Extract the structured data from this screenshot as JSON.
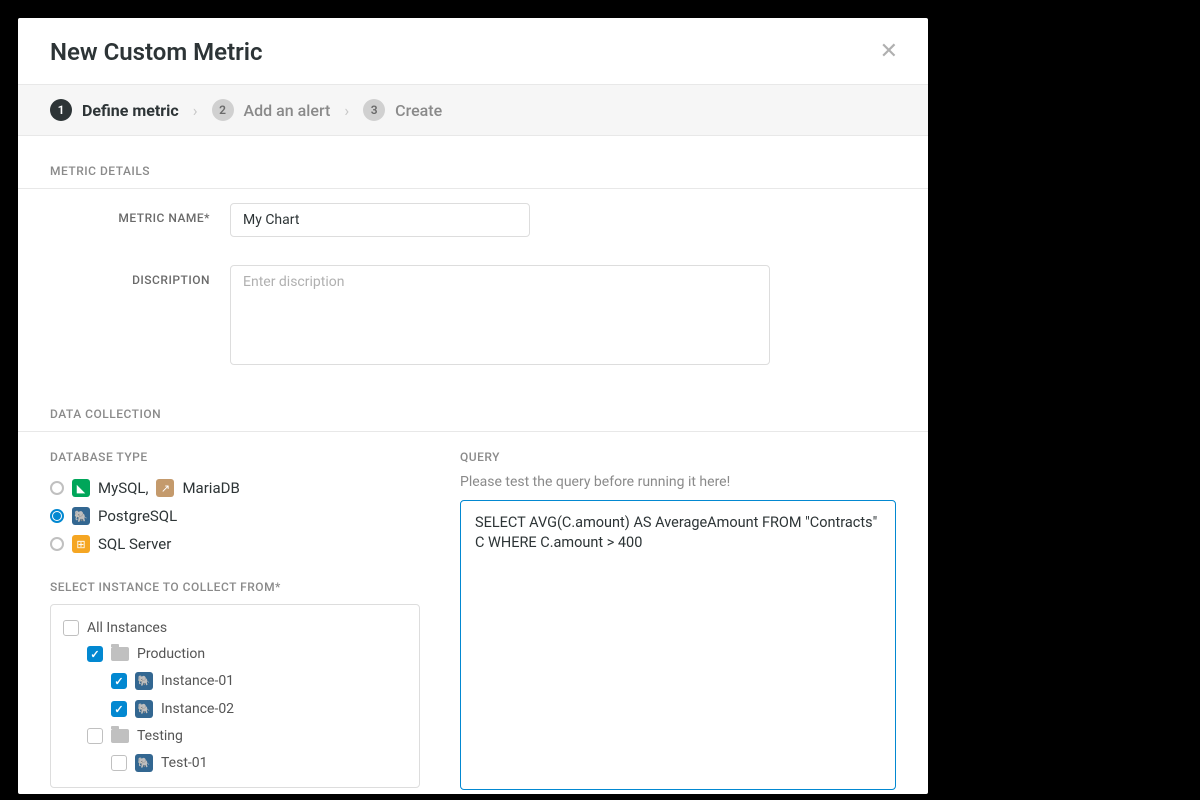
{
  "modal": {
    "title": "New Custom Metric"
  },
  "steps": [
    {
      "num": "1",
      "label": "Define metric"
    },
    {
      "num": "2",
      "label": "Add an alert"
    },
    {
      "num": "3",
      "label": "Create"
    }
  ],
  "sections": {
    "details": "METRIC DETAILS",
    "collection": "DATA COLLECTION"
  },
  "form": {
    "name_label": "METRIC NAME*",
    "name_value": "My Chart",
    "desc_label": "DISCRIPTION",
    "desc_placeholder": "Enter discription"
  },
  "db": {
    "label": "DATABASE TYPE",
    "mysql": "MySQL,",
    "maria": "MariaDB",
    "pg": "PostgreSQL",
    "mssql": "SQL Server"
  },
  "instance": {
    "label": "SELECT INSTANCE TO COLLECT FROM*",
    "all": "All Instances",
    "production": "Production",
    "inst01": "Instance-01",
    "inst02": "Instance-02",
    "testing": "Testing",
    "test01": "Test-01"
  },
  "query": {
    "label": "QUERY",
    "hint": "Please test the query before running it here!",
    "value": "SELECT AVG(C.amount) AS AverageAmount FROM \"Contracts\" C WHERE C.amount > 400"
  }
}
